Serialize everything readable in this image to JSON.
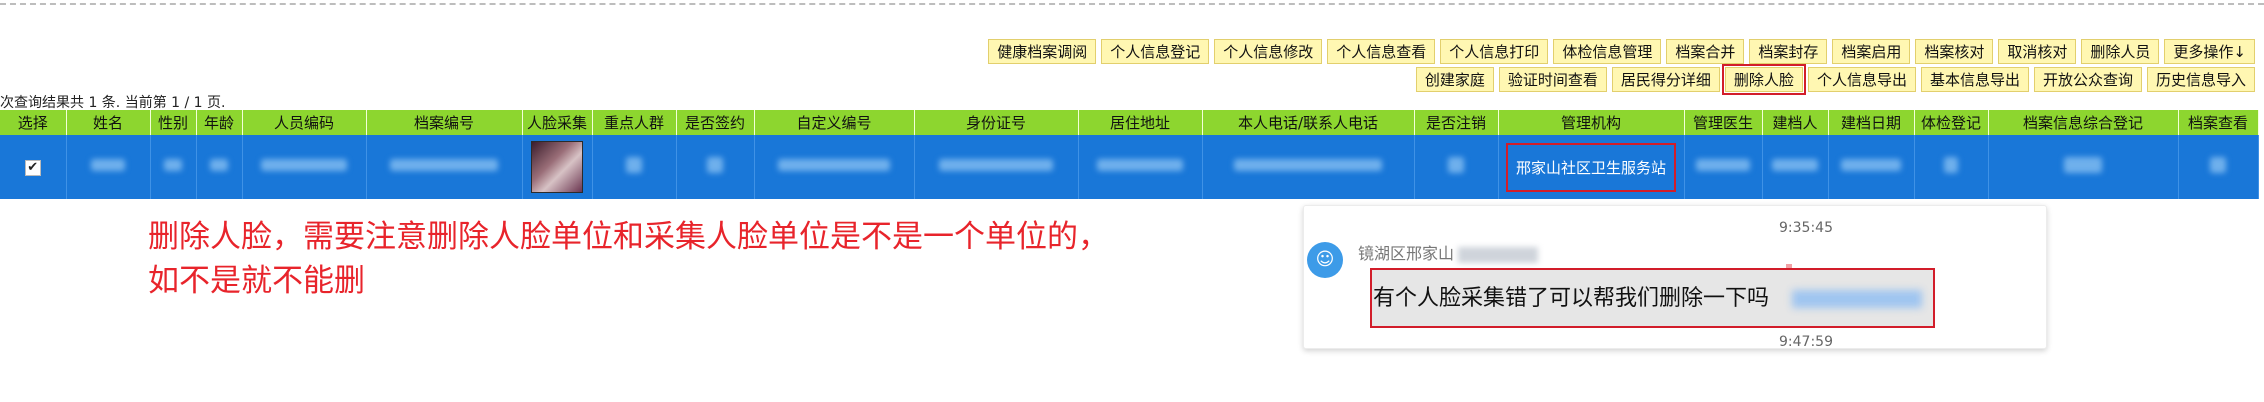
{
  "toolbar": {
    "row1": [
      "健康档案调阅",
      "个人信息登记",
      "个人信息修改",
      "个人信息查看",
      "个人信息打印",
      "体检信息管理",
      "档案合并",
      "档案封存",
      "档案启用",
      "档案核对",
      "取消核对",
      "删除人员",
      "更多操作↓"
    ],
    "row2": [
      "创建家庭",
      "验证时间查看",
      "居民得分详细",
      "删除人脸",
      "个人信息导出",
      "基本信息导出",
      "开放公众查询",
      "历史信息导入"
    ]
  },
  "result_summary": "次查询结果共 1 条. 当前第 1 / 1 页.",
  "table": {
    "headers": [
      "选择",
      "姓名",
      "性别",
      "年龄",
      "人员编码",
      "档案编号",
      "人脸采集",
      "重点人群",
      "是否签约",
      "自定义编号",
      "身份证号",
      "居住地址",
      "本人电话/联系人电话",
      "是否注销",
      "管理机构",
      "管理医生",
      "建档人",
      "建档日期",
      "体检登记",
      "档案信息综合登记",
      "档案查看"
    ],
    "row": {
      "selected": "✔",
      "management_org": "邢家山社区卫生服务站"
    }
  },
  "annotation": {
    "line1": "删除人脸，需要注意删除人脸单位和采集人脸单位是不是一个单位的，",
    "line2": "如不是就不能删"
  },
  "chat": {
    "sender": "镜湖区邢家山",
    "time_top": "9:35:45",
    "message": "有个人脸采集错了可以帮我们删除一下吗",
    "time_bottom": "9:47:59"
  },
  "colors": {
    "header_green": "#8dd62f",
    "row_blue": "#1977d8",
    "annotation_red": "#e8242b",
    "button_yellow": "#fff7b2"
  }
}
